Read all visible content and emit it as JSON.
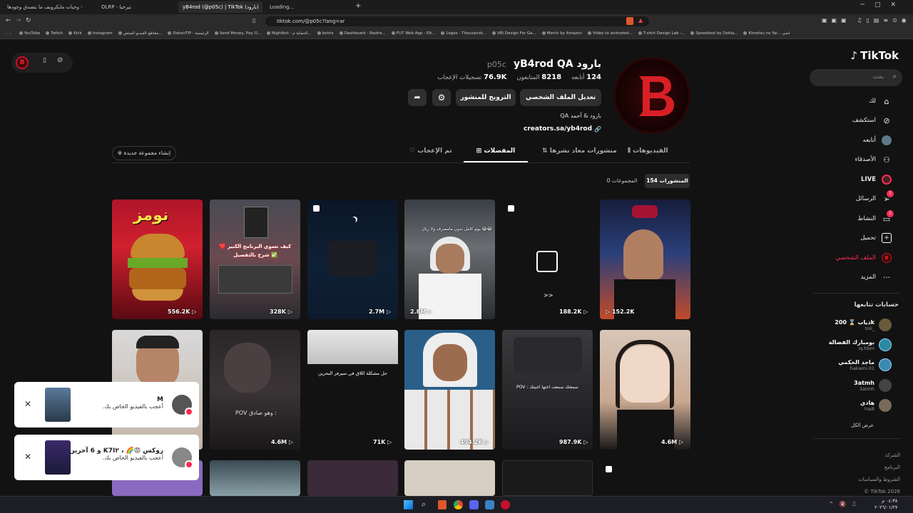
{
  "browser": {
    "tabs": [
      {
        "label": "وجبات مايكرويف ما بتصدق وجودها -"
      },
      {
        "label": "OLRP - نيرخيا"
      },
      {
        "label": "yB4rod (@p05c) | TikTok (بارود)"
      },
      {
        "label": "Loading..."
      }
    ],
    "new_tab": "+",
    "url": "tiktok.com/@p05c?lang=ar",
    "bookmarks": [
      "YouTube",
      "Twitch",
      "Kick",
      "Instagram",
      "مقاطع الفيديو المنتص...",
      "DokanTIP - الرئيسية",
      "Send Money, Pay O...",
      "Nightbot - الحماية م...",
      "botrix",
      "Dashboard - Restre...",
      "FUT Web App - EA...",
      "Logos - Thousands...",
      "VBi Design For Ga...",
      "Merch by Amazon",
      "Video to animated...",
      "T-shirt Design Lab -...",
      "Speedtest by Ookla...",
      "Kimetsu no Yai... انمي"
    ]
  },
  "sidebar": {
    "logo": "TikTok",
    "search_placeholder": "بحث",
    "items": [
      {
        "label": "لك",
        "icon": "home-icon"
      },
      {
        "label": "استكشف",
        "icon": "compass-icon"
      },
      {
        "label": "أتابعه",
        "icon": "avatar"
      },
      {
        "label": "الأصدقاء",
        "icon": "friends-icon"
      },
      {
        "label": "LIVE",
        "icon": "live-icon"
      },
      {
        "label": "الرسائل",
        "icon": "send-icon",
        "badge": "1"
      },
      {
        "label": "النشاط",
        "icon": "activity-icon",
        "badge": "2"
      },
      {
        "label": "تحميل",
        "icon": "upload-icon"
      },
      {
        "label": "الملف الشخصي",
        "icon": "profile-icon"
      },
      {
        "label": "المزيد",
        "icon": "more-icon"
      }
    ],
    "following_title": "حسابات تتابعها",
    "following": [
      {
        "name": "ذياب ⌛ 200k",
        "handle": "toli_",
        "color": "#6a5a3a"
      },
      {
        "name": "بومبارك الفضالة",
        "handle": "iq.hbm",
        "color": "#2a8aa0"
      },
      {
        "name": "ماجد الحكمي",
        "handle": "hakami.01",
        "color": "#3a8ab0"
      },
      {
        "name": "3atmh",
        "handle": "3atmh",
        "color": "#444"
      },
      {
        "name": "هادي",
        "handle": "hadi",
        "color": "#7a6a5a"
      }
    ],
    "see_all": "عرض الكل",
    "footer": [
      "الشركة",
      "البرنامج",
      "الشروط والسياسات",
      "© TikTok 2026"
    ]
  },
  "profile": {
    "display_name": "بارود yB4rod QA",
    "username": "p05c",
    "following_count": "124",
    "following_label": "أتابعه",
    "followers_count": "8218",
    "followers_label": "المتابعون",
    "likes_count": "76.9K",
    "likes_label": "تسجيلات الإعجاب",
    "edit_profile": "تعديل الملف الشخصي",
    "promote": "الترويج للمنشور",
    "bio": "بارود & أحمد QA",
    "link": "creators.sa/yb4rod"
  },
  "tabs": [
    {
      "label": "الفيديوهات"
    },
    {
      "label": "منشورات معاد نشرها"
    },
    {
      "label": "المفضلات"
    },
    {
      "label": "تم الإعجاب"
    }
  ],
  "create_collection": "إنشاء مجموعة جديدة",
  "subtabs": {
    "posts": "المنشورات 154",
    "collections": "المجموعات 0"
  },
  "videos_row1": [
    {
      "views": "152.2K"
    },
    {
      "views": "188.2K",
      "caption": ">>"
    },
    {
      "views": "2.8M",
      "caption": "يوم كامل بدون مامصرف ولا ريال 😂😂"
    },
    {
      "views": "2.7M"
    },
    {
      "views": "328K",
      "caption": "كيف تسوي البرنامج الكبير ❤️ شرح بالتفصيل ✅"
    },
    {
      "views": "556.2K",
      "caption": "نومز"
    }
  ],
  "videos_row2": [
    {
      "views": "4.6M"
    },
    {
      "views": "987.9K",
      "caption": "POV : سمعتك سمعت اختها اغنيتك"
    },
    {
      "views": "494.2K"
    },
    {
      "views": "71K",
      "caption": "حل مشكلة اللاق في سيرفر البحرين"
    },
    {
      "views": "4.6M",
      "caption": "POV وهو صادق :"
    }
  ],
  "toasts": [
    {
      "name": "M",
      "text": "أعجب بالفيديو الخاص بك."
    },
    {
      "name": "روكس 😡🌈 ، K7I٢ و 6 آخرين",
      "text": "أعجب بالفيديو الخاص بك."
    }
  ],
  "taskbar": {
    "time": "٠٤:٣٨ م",
    "date": "٢٠٢٦/٠١/٢٧"
  },
  "colors": {
    "accent": "#fe2c55",
    "brand_red": "#c8102e"
  }
}
